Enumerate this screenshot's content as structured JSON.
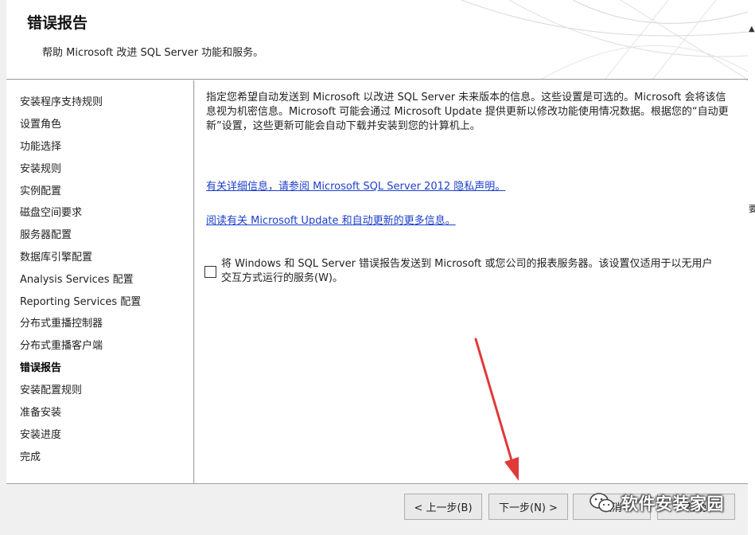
{
  "header": {
    "title": "错误报告",
    "subtitle": "帮助 Microsoft 改进 SQL Server 功能和服务。"
  },
  "sidebar": {
    "items": [
      {
        "label": "安装程序支持规则",
        "active": false
      },
      {
        "label": "设置角色",
        "active": false
      },
      {
        "label": "功能选择",
        "active": false
      },
      {
        "label": "安装规则",
        "active": false
      },
      {
        "label": "实例配置",
        "active": false
      },
      {
        "label": "磁盘空间要求",
        "active": false
      },
      {
        "label": "服务器配置",
        "active": false
      },
      {
        "label": "数据库引擎配置",
        "active": false
      },
      {
        "label": "Analysis Services 配置",
        "active": false
      },
      {
        "label": "Reporting Services 配置",
        "active": false
      },
      {
        "label": "分布式重播控制器",
        "active": false
      },
      {
        "label": "分布式重播客户端",
        "active": false
      },
      {
        "label": "错误报告",
        "active": true
      },
      {
        "label": "安装配置规则",
        "active": false
      },
      {
        "label": "准备安装",
        "active": false
      },
      {
        "label": "安装进度",
        "active": false
      },
      {
        "label": "完成",
        "active": false
      }
    ]
  },
  "content": {
    "intro": "指定您希望自动发送到 Microsoft 以改进 SQL Server 未来版本的信息。这些设置是可选的。Microsoft 会将该信息视为机密信息。Microsoft 可能会通过 Microsoft Update 提供更新以修改功能使用情况数据。根据您的“自动更新”设置，这些更新可能会自动下载并安装到您的计算机上。",
    "link_privacy": "有关详细信息，请参阅 Microsoft SQL Server 2012 隐私声明。",
    "link_update": "阅读有关 Microsoft Update 和自动更新的更多信息。",
    "checkbox_label": "将 Windows 和 SQL Server 错误报告发送到 Microsoft 或您公司的报表服务器。该设置仅适用于以无用户交互方式运行的服务(W)。",
    "checkbox_checked": false
  },
  "footer": {
    "back_label": "< 上一步(B)",
    "next_label": "下一步(N) >",
    "cancel_label": "取消",
    "help_label": "帮助"
  },
  "watermark": {
    "text": "软件安装家园"
  },
  "edge": {
    "up_arrow": "▲",
    "char": "要"
  },
  "colors": {
    "link": "#1d3fcb",
    "arrow": "#e0393a",
    "panel_bg": "#ffffff",
    "chrome_bg": "#f0f0f0"
  }
}
